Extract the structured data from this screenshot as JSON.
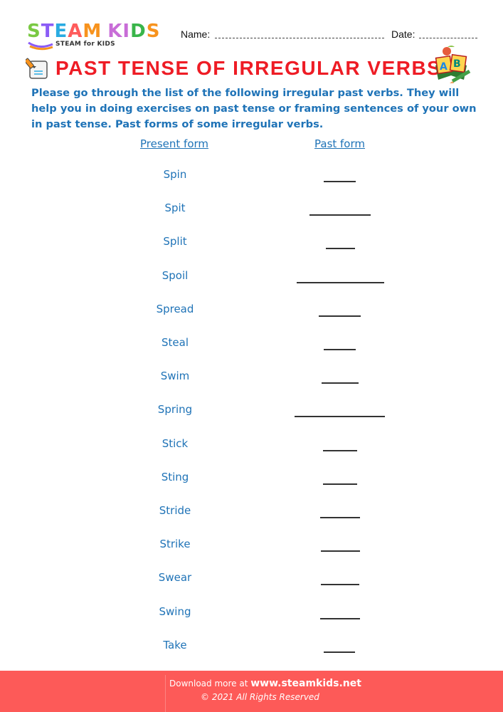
{
  "logo": {
    "letters": [
      {
        "char": "S",
        "color": "#7ac943"
      },
      {
        "char": "T",
        "color": "#8b5cf6"
      },
      {
        "char": "E",
        "color": "#29abe2"
      },
      {
        "char": "A",
        "color": "#ff5b5b"
      },
      {
        "char": "M",
        "color": "#f7931e"
      },
      {
        "char": " ",
        "color": "#000000"
      },
      {
        "char": "K",
        "color": "#c86dd7"
      },
      {
        "char": "I",
        "color": "#c86dd7"
      },
      {
        "char": "D",
        "color": "#39b54a"
      },
      {
        "char": "S",
        "color": "#f7931e"
      }
    ],
    "subtitle": "STEAM for KIDS"
  },
  "header": {
    "name_label": "Name:",
    "date_label": "Date:"
  },
  "title": "PAST TENSE OF IRREGULAR VERBS",
  "intro": "Please go through the list of the following irregular past verbs. They will help you in doing exercises on past tense or framing sentences of your own in past tense. Past forms of some irregular verbs.",
  "table": {
    "headers": [
      "Present form",
      "Past form"
    ],
    "rows": [
      {
        "present": "Spin",
        "past": ""
      },
      {
        "present": "Spit",
        "past": ""
      },
      {
        "present": "Split",
        "past": ""
      },
      {
        "present": "Spoil",
        "past": ""
      },
      {
        "present": "Spread",
        "past": ""
      },
      {
        "present": "Steal",
        "past": ""
      },
      {
        "present": "Swim",
        "past": ""
      },
      {
        "present": "Spring",
        "past": ""
      },
      {
        "present": "Stick",
        "past": ""
      },
      {
        "present": "Sting",
        "past": ""
      },
      {
        "present": "Stride",
        "past": ""
      },
      {
        "present": "Strike",
        "past": ""
      },
      {
        "present": "Swear",
        "past": ""
      },
      {
        "present": "Swing",
        "past": ""
      },
      {
        "present": "Take",
        "past": ""
      }
    ]
  },
  "footer": {
    "download_text": "Download more at",
    "url": "www.steamkids.net",
    "copyright": "©  2021 All Rights Reserved"
  },
  "colors": {
    "title": "#ee1c25",
    "text_blue": "#1f73b7",
    "footer_bg": "#fd5a58"
  }
}
